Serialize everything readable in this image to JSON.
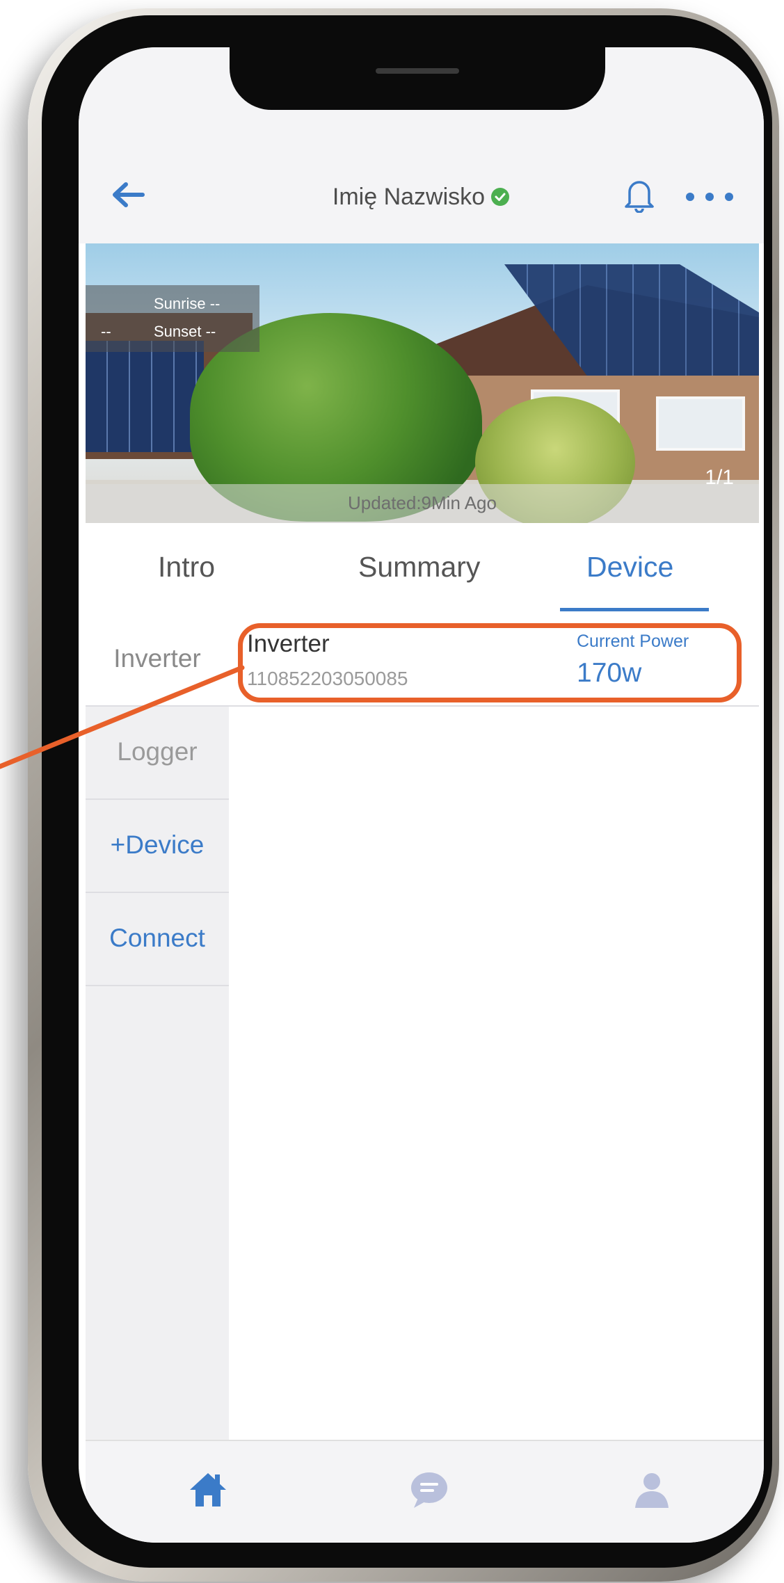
{
  "header": {
    "title": "Imię Nazwisko"
  },
  "hero": {
    "sunrise_label": "Sunrise --",
    "sunset_label": "Sunset --",
    "left_dash": "--",
    "counter": "1/1",
    "updated": "Updated:9Min Ago"
  },
  "tabs": [
    {
      "label": "Intro"
    },
    {
      "label": "Summary"
    },
    {
      "label": "Device"
    }
  ],
  "side_menu": [
    {
      "label": "Inverter"
    },
    {
      "label": "Logger"
    },
    {
      "label": "+Device"
    },
    {
      "label": "Connect"
    }
  ],
  "device": {
    "name": "Inverter",
    "serial": "110852203050085",
    "current_power_label": "Current Power",
    "current_power_value": "170w"
  },
  "bottom_nav": [
    {
      "icon": "home-icon"
    },
    {
      "icon": "chat-icon"
    },
    {
      "icon": "user-icon"
    }
  ],
  "colors": {
    "accent": "#3b7bc8",
    "highlight": "#e8602a",
    "verified": "#4caf50"
  }
}
